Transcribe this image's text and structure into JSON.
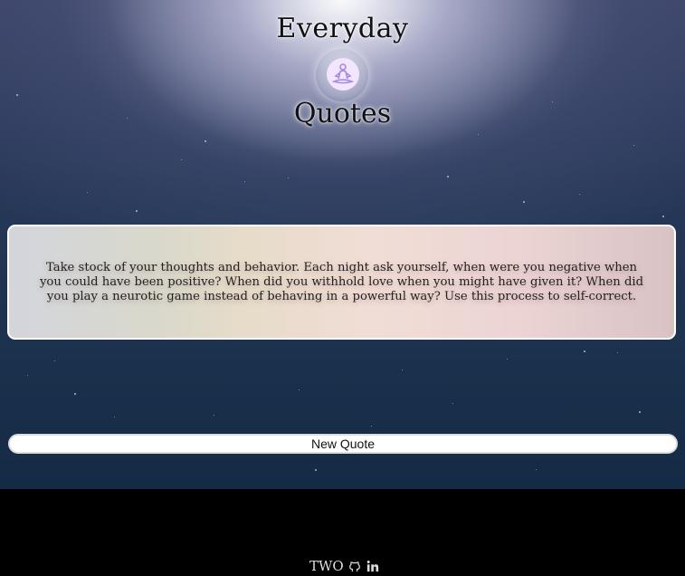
{
  "header": {
    "title_top": "Everyday",
    "title_bottom": "Quotes",
    "logo_icon": "meditation-icon"
  },
  "quote": {
    "text": "Take stock of your thoughts and behavior. Each night ask yourself, when were you negative when you could have been positive? When did you withhold love when you might have given it? When did you play a neurotic game instead of behaving in a powerful way? Use this process to self-correct."
  },
  "actions": {
    "new_quote_label": "New Quote"
  },
  "footer": {
    "brand": "TWO",
    "icons": [
      "github-icon",
      "linkedin-icon"
    ]
  },
  "colors": {
    "accent": "#a98bd8",
    "background_dark": "#000000",
    "button_bg": "#ffffff"
  }
}
